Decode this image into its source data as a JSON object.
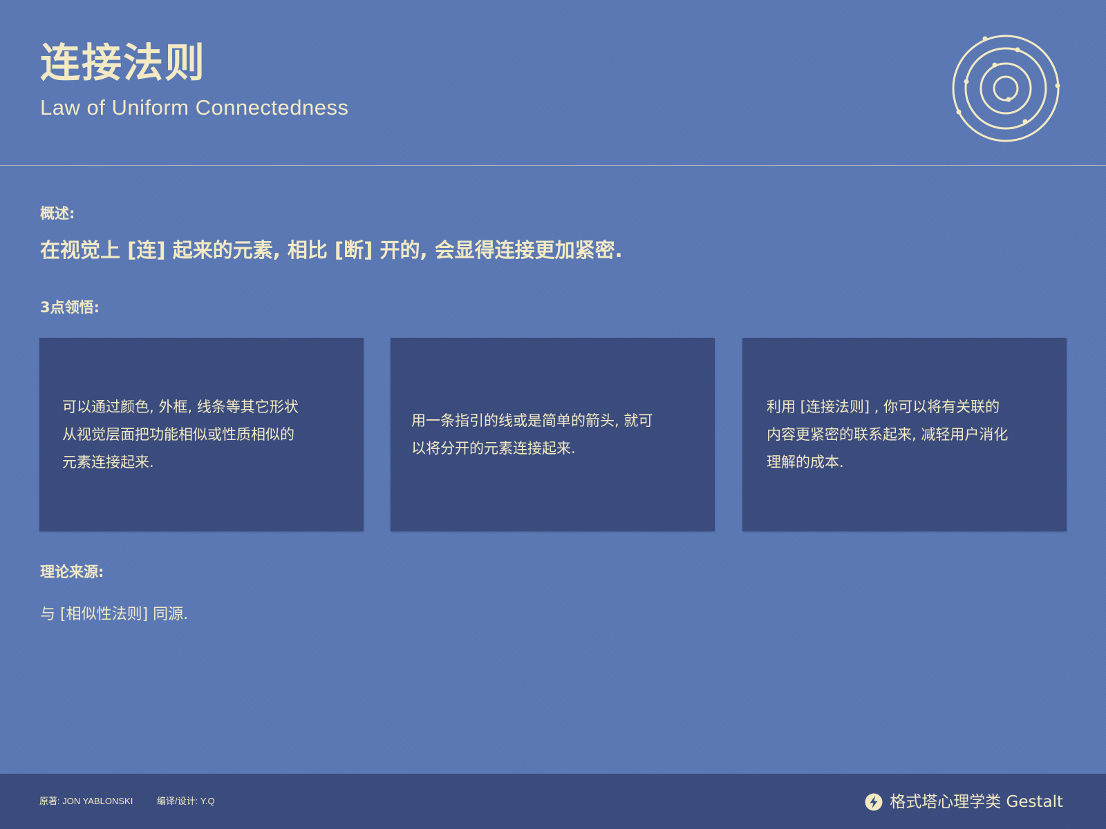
{
  "header": {
    "title": "连接法则",
    "subtitle": "Law of Uniform Connectedness",
    "logo_icon": "concentric-circles-orbit-icon"
  },
  "overview": {
    "label": "概述:",
    "text": "在视觉上 [连] 起来的元素, 相比 [断] 开的, 会显得连接更加紧密."
  },
  "insights": {
    "label": "3点领悟:",
    "cards": [
      {
        "lines": [
          "可以通过颜色, 外框, 线条等其它形状",
          "从视觉层面把功能相似或性质相似的",
          "元素连接起来."
        ]
      },
      {
        "lines": [
          "用一条指引的线或是简单的箭头, 就可",
          "以将分开的元素连接起来."
        ]
      },
      {
        "lines": [
          "利用 [连接法则] , 你可以将有关联的",
          "内容更紧密的联系起来, 减轻用户消化",
          "理解的成本."
        ]
      }
    ]
  },
  "source": {
    "label": "理论来源:",
    "text": "与 [相似性法则] 同源."
  },
  "footer": {
    "author_credit": "原著: JON YABLONSKI",
    "design_credit": "编译/设计: Y.Q",
    "brand_icon": "lightning-bolt-icon",
    "brand": "格式塔心理学类 Gestalt"
  },
  "colors": {
    "background": "#5a78b5",
    "card": "#394a7c",
    "text": "#f3eac4"
  }
}
